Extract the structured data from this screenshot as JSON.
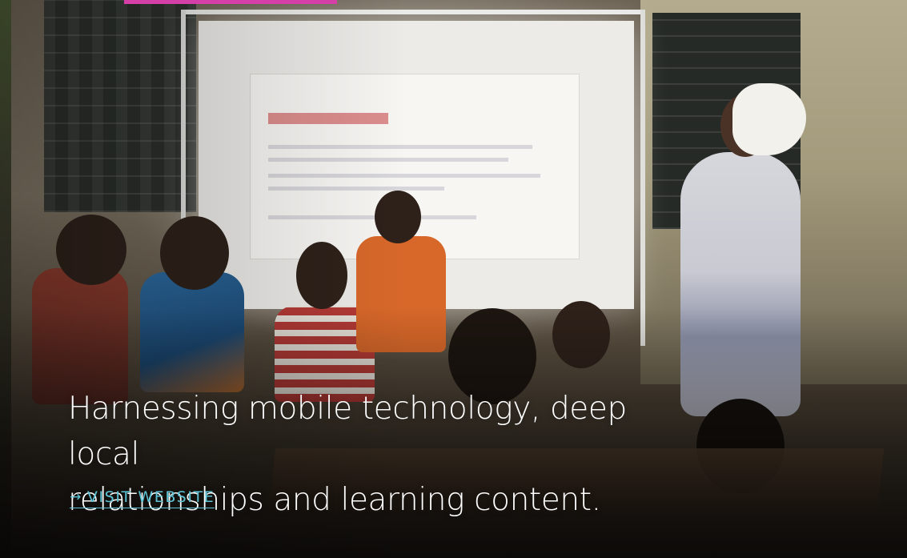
{
  "hero": {
    "accent_color": "#d43fa8",
    "headline": "Harnessing mobile technology, deep local\nrelationships and learning content.",
    "cta": {
      "arrow_icon": "arrow-right-icon",
      "arrow_glyph": "→",
      "label": "VISIT WEBSITE",
      "color": "#5cc3d6"
    },
    "image_alt_icon": "classroom-photo"
  }
}
